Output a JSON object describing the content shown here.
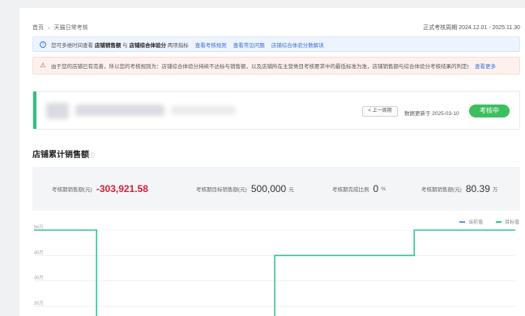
{
  "breadcrumb": {
    "home": "首页",
    "current": "天猫日常考核"
  },
  "period": "正式考核周期 2024.12.01 - 2025.11.30",
  "notices": {
    "info": {
      "text1": "您可多维时间查看",
      "bold1": "店铺销售额",
      "text2": "与",
      "bold2": "店铺综合体验分",
      "text3": "两项指标",
      "links": [
        "查看考核规则",
        "查看常见问题",
        "店铺综合体验分数解读"
      ]
    },
    "warn": {
      "text": "由于您的店铺已有完善，所以您的考核规则为：店铺综合体验分持续不达标与销售额，以及店铺所在主营类目考核要求中的最低标准为准，店铺销售额与综合体验分考核结果的判定依据如下：",
      "link": "查看更多"
    }
  },
  "store_card": {
    "prev_button": "< 上一周期",
    "update_text": "数据更新于 2025-03-10",
    "status_button": "考核中"
  },
  "section": {
    "title": "店铺累计销售额",
    "help_icon": "question-circle-icon"
  },
  "stats": [
    {
      "label": "考核期销售额(元)",
      "value": "-303,921.58",
      "unit": "",
      "negative": true
    },
    {
      "label": "考核期目标销售额(元)",
      "value": "500,000",
      "unit": "元",
      "negative": false
    },
    {
      "label": "考核期完成比例",
      "value": "0",
      "unit": "%",
      "negative": false
    },
    {
      "label": "考核期销售额(元)",
      "value": "80.39",
      "unit": "万",
      "negative": false
    }
  ],
  "chart_data": {
    "type": "line",
    "y_ticks": [
      "50万",
      "40万",
      "30万",
      "20万"
    ],
    "ylim_wan": [
      15,
      52
    ],
    "legend": [
      {
        "name": "当前值",
        "color": "#5b8ff9"
      },
      {
        "name": "目标值",
        "color": "#2ec88e"
      }
    ],
    "series": [
      {
        "name": "目标值",
        "color": "#2ec88e",
        "points": [
          [
            0,
            50
          ],
          [
            0.13,
            50
          ],
          [
            0.13,
            0
          ],
          [
            0.5,
            0
          ],
          [
            0.5,
            40
          ],
          [
            0.79,
            40
          ],
          [
            0.79,
            50
          ],
          [
            1,
            50
          ]
        ]
      }
    ]
  }
}
